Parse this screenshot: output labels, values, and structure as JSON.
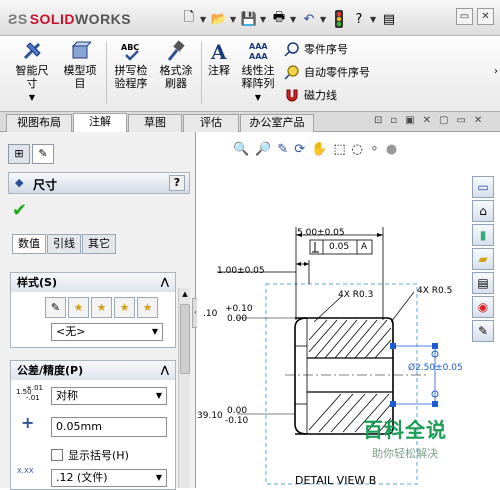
{
  "app": {
    "logo_left": "SOLID",
    "logo_right": "WORKS"
  },
  "quick_access": [
    "new-file-icon",
    "open-folder-icon",
    "save-icon",
    "print-icon",
    "undo-icon",
    "rebuild-traffic-light-icon",
    "help-icon",
    "file-properties-icon"
  ],
  "ribbon": {
    "smart_dim_l1": "智能尺",
    "smart_dim_l2": "寸",
    "model_items_l1": "模型项",
    "model_items_l2": "目",
    "spell_l1": "拼写检",
    "spell_l2": "验程序",
    "format_l1": "格式涂",
    "format_l2": "刷器",
    "note": "注释",
    "linear_l1": "线性注",
    "linear_l2": "释阵列",
    "balloon": "零件序号",
    "auto_balloon": "自动零件序号",
    "magnetic_line": "磁力线"
  },
  "tabs": [
    "视图布局",
    "注解",
    "草图",
    "评估",
    "办公室产品"
  ],
  "active_tab": "注解",
  "panel": {
    "title": "尺寸",
    "help": "?",
    "subtabs": [
      "数值",
      "引线",
      "其它"
    ],
    "style_header": "样式(S)",
    "style_select": "<无>",
    "tol_header": "公差/精度(P)",
    "tol_type": "对称",
    "tol_value": "0.05mm",
    "show_paren": "显示括号(H)",
    "precision": ".12 (文件)",
    "tol_icon_top": "1.50",
    "tol_icon_sup": "+.01",
    "tol_icon_sub": "-.01"
  },
  "drawing": {
    "dim_width": "5.00±0.05",
    "gdt_value": "0.05",
    "gdt_datum": "A",
    "dim_left_top": "1.00±0.05",
    "dim_tol_upper": "+0.10",
    "dim_tol_lower": "0.00",
    "dim_tol_prefix": ".10",
    "radius_label": "4X R0.3",
    "radius_label2": "4X R0.5",
    "diameter": "Ø2.50±0.05",
    "dim_bottom_upper": "0.00",
    "dim_bottom_lower": "-0.10",
    "dim_bottom_prefix": "39.10",
    "view_label": "DETAIL VIEW B"
  },
  "watermark": {
    "title": "百科全说",
    "subtitle": "助你轻松解决"
  },
  "colors": {
    "accent": "#c8102e",
    "selection": "#1e5bd8",
    "watermark": "#1a9e57"
  }
}
